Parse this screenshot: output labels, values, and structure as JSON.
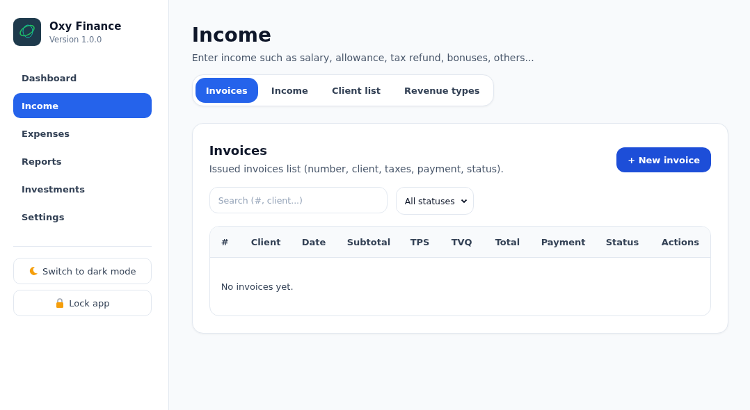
{
  "app": {
    "name": "Oxy Finance",
    "version": "Version 1.0.0"
  },
  "sidebar": {
    "items": [
      {
        "label": "Dashboard",
        "selected": false
      },
      {
        "label": "Income",
        "selected": true
      },
      {
        "label": "Expenses",
        "selected": false
      },
      {
        "label": "Reports",
        "selected": false
      },
      {
        "label": "Investments",
        "selected": false
      },
      {
        "label": "Settings",
        "selected": false
      }
    ],
    "buttons": [
      {
        "kind": "theme",
        "label": "Switch to dark mode"
      },
      {
        "kind": "lock",
        "label": "Lock app"
      }
    ]
  },
  "page": {
    "title": "Income",
    "subtitle": "Enter income such as salary, allowance, tax refund, bonuses, others..."
  },
  "tabs": [
    {
      "label": "Invoices",
      "selected": true
    },
    {
      "label": "Income",
      "selected": false
    },
    {
      "label": "Client list",
      "selected": false
    },
    {
      "label": "Revenue types",
      "selected": false
    }
  ],
  "card": {
    "title": "Invoices",
    "subtitle": "Issued invoices list (number, client, taxes, payment, status).",
    "new_button": "+ New invoice",
    "search": {
      "placeholder": "Search (#, client...)"
    },
    "status_filter": {
      "value": "All statuses"
    },
    "table": {
      "columns": [
        "#",
        "Client",
        "Date",
        "Subtotal",
        "TPS",
        "TVQ",
        "Total",
        "Payment",
        "Status",
        "Actions"
      ],
      "empty_message": "No invoices yet."
    }
  }
}
